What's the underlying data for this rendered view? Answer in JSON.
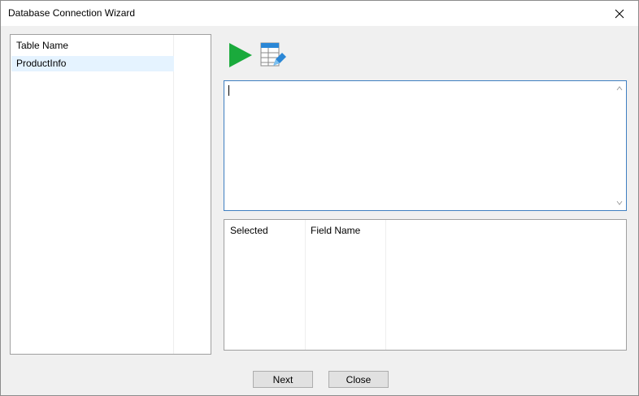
{
  "window": {
    "title": "Database Connection Wizard"
  },
  "table_list": {
    "header": "Table Name",
    "items": [
      "ProductInfo"
    ]
  },
  "toolbar": {
    "run_icon": "play-icon",
    "design_icon": "table-edit-icon"
  },
  "sql_editor": {
    "value": ""
  },
  "field_grid": {
    "columns": [
      "Selected",
      "Field Name"
    ]
  },
  "buttons": {
    "next": "Next",
    "close": "Close"
  },
  "colors": {
    "selection": "#e5f3ff",
    "focus_border": "#3f7fc1",
    "run_green": "#1aaa3c",
    "accent_blue": "#2b87d6"
  }
}
